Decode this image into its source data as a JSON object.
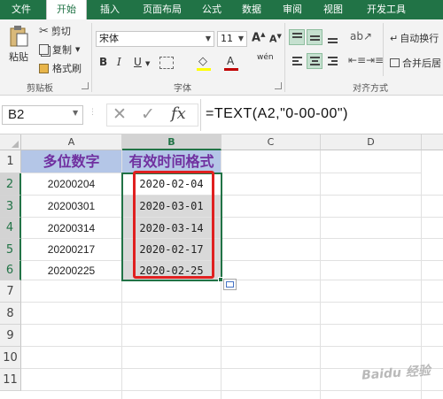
{
  "ribbon_tabs": [
    "文件",
    "开始",
    "插入",
    "页面布局",
    "公式",
    "数据",
    "审阅",
    "视图",
    "开发工具"
  ],
  "active_tab": "开始",
  "clipboard": {
    "paste": "粘贴",
    "cut": "剪切",
    "copy": "复制",
    "painter": "格式刷",
    "group": "剪贴板"
  },
  "font": {
    "name": "宋体",
    "size": "11",
    "grow": "A",
    "shrink": "A",
    "bold": "B",
    "italic": "I",
    "underline": "U",
    "color_glyph": "A",
    "phonetic": "wén",
    "group": "字体"
  },
  "alignment": {
    "wrap": "自动换行",
    "merge": "合并后居",
    "group": "对齐方式"
  },
  "formula_bar": {
    "name_box": "B2",
    "cancel": "✕",
    "enter": "✓",
    "fx": "fx",
    "formula": "=TEXT(A2,\"0-00-00\")"
  },
  "columns": [
    "A",
    "B",
    "C",
    "D"
  ],
  "rows": [
    "1",
    "2",
    "3",
    "4",
    "5",
    "6",
    "7",
    "8",
    "9",
    "10",
    "11"
  ],
  "table": {
    "headers": [
      "多位数字",
      "有效时间格式"
    ],
    "col_a": [
      "20200204",
      "20200301",
      "20200314",
      "20200217",
      "20200225"
    ],
    "col_b": [
      "2020-02-04",
      "2020-03-01",
      "2020-03-14",
      "2020-02-17",
      "2020-02-25"
    ]
  },
  "colors": {
    "ribbon": "#217346",
    "header_fill": "#b4c6e7",
    "header_text": "#7030a0",
    "highlight_box": "#e02020",
    "selection": "#217346"
  },
  "watermark": "Baidu 经验"
}
